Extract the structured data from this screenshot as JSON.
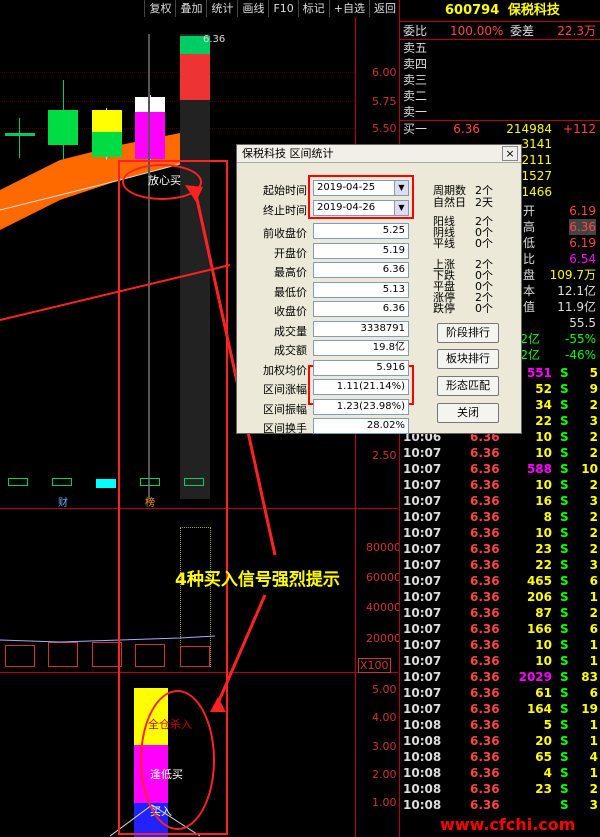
{
  "toolbar": {
    "buttons": [
      "复权",
      "叠加",
      "统计",
      "画线",
      "F10",
      "标记",
      "+自选",
      "返回"
    ]
  },
  "chart": {
    "price_labels": [
      "6.00",
      "5.75",
      "5.50",
      "2.50"
    ],
    "high_label": "6.36",
    "volume_labels": [
      "80000",
      "60000",
      "40000",
      "20000"
    ],
    "volume_unit": "X100",
    "indicator_labels": [
      "5.00",
      "4.00",
      "3.00",
      "2.00",
      "1.00"
    ],
    "tag_cai": "财",
    "tag_bang": "榜",
    "signal_fangxinmai": "放心买",
    "signal_quancang": "全仓杀入",
    "signal_didimai": "逢低买",
    "signal_last": "买入",
    "headline": "4种买入信号强烈提示"
  },
  "quote": {
    "code": "600794",
    "name": "保税科技",
    "weibi_label": "委比",
    "weibi_value": "100.00%",
    "weicha_label": "委差",
    "weicha_value": "22.3万",
    "sell_levels": [
      "卖五",
      "卖四",
      "卖三",
      "卖二",
      "卖一"
    ],
    "buy1": {
      "label": "买一",
      "price": "6.36",
      "vol": "214984",
      "chg": "+112"
    },
    "buy_vols": [
      "3141",
      "2111",
      "1527",
      "1466"
    ],
    "side_rows": [
      {
        "lbl": "开",
        "val": "6.19"
      },
      {
        "lbl": "高",
        "val": "6.36"
      },
      {
        "lbl": "低",
        "val": "6.19"
      },
      {
        "lbl": "比",
        "val": "6.54"
      },
      {
        "lbl": "盘",
        "val": "109.7万"
      },
      {
        "lbl": "本",
        "val": "12.1亿"
      },
      {
        "lbl": "值",
        "val": "11.9亿"
      },
      {
        "lbl": "",
        "val": "55.5"
      }
    ],
    "stat1": {
      "a": "5.32亿",
      "b": "-55%"
    },
    "stat2": {
      "a": "4.52亿",
      "b": "-46%"
    },
    "ticks": [
      {
        "t": "",
        "p": "",
        "v": "551",
        "s": "S",
        "n": "5"
      },
      {
        "t": "",
        "p": "",
        "v": "52",
        "s": "S",
        "n": "9"
      },
      {
        "t": "",
        "p": "",
        "v": "34",
        "s": "S",
        "n": "2"
      },
      {
        "t": "",
        "p": "",
        "v": "22",
        "s": "S",
        "n": "3"
      },
      {
        "t": "10:06",
        "p": "6.36",
        "v": "10",
        "s": "S",
        "n": "2"
      },
      {
        "t": "10:07",
        "p": "6.36",
        "v": "10",
        "s": "S",
        "n": "2"
      },
      {
        "t": "10:07",
        "p": "6.36",
        "v": "588",
        "s": "S",
        "n": "10"
      },
      {
        "t": "10:07",
        "p": "6.36",
        "v": "10",
        "s": "S",
        "n": "2"
      },
      {
        "t": "10:07",
        "p": "6.36",
        "v": "16",
        "s": "S",
        "n": "3"
      },
      {
        "t": "10:07",
        "p": "6.36",
        "v": "8",
        "s": "S",
        "n": "2"
      },
      {
        "t": "10:07",
        "p": "6.36",
        "v": "10",
        "s": "S",
        "n": "2"
      },
      {
        "t": "10:07",
        "p": "6.36",
        "v": "23",
        "s": "S",
        "n": "2"
      },
      {
        "t": "10:07",
        "p": "6.36",
        "v": "22",
        "s": "S",
        "n": "3"
      },
      {
        "t": "10:07",
        "p": "6.36",
        "v": "465",
        "s": "S",
        "n": "6"
      },
      {
        "t": "10:07",
        "p": "6.36",
        "v": "206",
        "s": "S",
        "n": "1"
      },
      {
        "t": "10:07",
        "p": "6.36",
        "v": "87",
        "s": "S",
        "n": "2"
      },
      {
        "t": "10:07",
        "p": "6.36",
        "v": "166",
        "s": "S",
        "n": "6"
      },
      {
        "t": "10:07",
        "p": "6.36",
        "v": "10",
        "s": "S",
        "n": "1"
      },
      {
        "t": "10:07",
        "p": "6.36",
        "v": "10",
        "s": "S",
        "n": "1"
      },
      {
        "t": "10:07",
        "p": "6.36",
        "v": "2029",
        "s": "S",
        "n": "83"
      },
      {
        "t": "10:07",
        "p": "6.36",
        "v": "61",
        "s": "S",
        "n": "6"
      },
      {
        "t": "10:07",
        "p": "6.36",
        "v": "164",
        "s": "S",
        "n": "19"
      },
      {
        "t": "10:08",
        "p": "6.36",
        "v": "5",
        "s": "S",
        "n": "1"
      },
      {
        "t": "10:08",
        "p": "6.36",
        "v": "20",
        "s": "S",
        "n": "1"
      },
      {
        "t": "10:08",
        "p": "6.36",
        "v": "65",
        "s": "S",
        "n": "4"
      },
      {
        "t": "10:08",
        "p": "6.36",
        "v": "4",
        "s": "S",
        "n": "1"
      },
      {
        "t": "10:08",
        "p": "6.36",
        "v": "23",
        "s": "S",
        "n": "2"
      },
      {
        "t": "10:08",
        "p": "6.36",
        "v": "",
        "s": "S",
        "n": "3"
      }
    ],
    "watermark": "www.cfchi.com"
  },
  "dialog": {
    "title": "保税科技 区间统计",
    "close": "×",
    "start_label": "起始时间",
    "start_value": "2019-04-25",
    "end_label": "终止时间",
    "end_value": "2019-04-26",
    "fields": [
      {
        "label": "前收盘价",
        "value": "5.25"
      },
      {
        "label": "开盘价",
        "value": "5.19"
      },
      {
        "label": "最高价",
        "value": "6.36"
      },
      {
        "label": "最低价",
        "value": "5.13"
      },
      {
        "label": "收盘价",
        "value": "6.36"
      },
      {
        "label": "成交量",
        "value": "3338791"
      },
      {
        "label": "成交额",
        "value": "19.8亿"
      },
      {
        "label": "加权均价",
        "value": "5.916"
      },
      {
        "label": "区间涨幅",
        "value": "1.11(21.14%)"
      },
      {
        "label": "区间振幅",
        "value": "1.23(23.98%)"
      },
      {
        "label": "区间换手",
        "value": "28.02%"
      }
    ],
    "stats": [
      {
        "k": "周期数",
        "v": "2个"
      },
      {
        "k": "自然日",
        "v": "2天"
      },
      {
        "k": "阳线",
        "v": "2个"
      },
      {
        "k": "阴线",
        "v": "0个"
      },
      {
        "k": "平线",
        "v": "0个"
      },
      {
        "k": "上涨",
        "v": "2个"
      },
      {
        "k": "下跌",
        "v": "0个"
      },
      {
        "k": "平盘",
        "v": "0个"
      },
      {
        "k": "涨停",
        "v": "2个"
      },
      {
        "k": "跌停",
        "v": "0个"
      }
    ],
    "buttons": [
      "阶段排行",
      "板块排行",
      "形态匹配",
      "关闭"
    ]
  }
}
